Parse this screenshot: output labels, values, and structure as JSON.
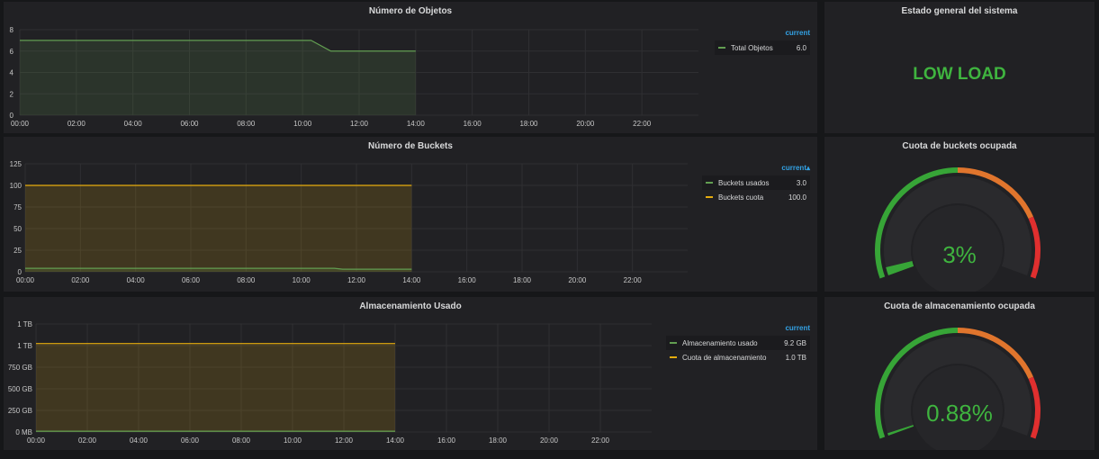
{
  "panels": {
    "objects": {
      "title": "Número de Objetos"
    },
    "status": {
      "title": "Estado general del sistema",
      "value": "LOW LOAD",
      "color": "#3fb43f"
    },
    "buckets": {
      "title": "Número de Buckets"
    },
    "bucket_quota": {
      "title": "Cuota de buckets ocupada",
      "value": "3%"
    },
    "storage": {
      "title": "Almacenamiento Usado"
    },
    "storage_quota": {
      "title": "Cuota de almacenamiento ocupada",
      "value": "0.88%"
    }
  },
  "legends": {
    "objects": {
      "header": "current",
      "items": [
        {
          "name": "Total Objetos",
          "value": "6.0",
          "color": "#629e51"
        }
      ]
    },
    "buckets": {
      "header": "current▴",
      "items": [
        {
          "name": "Buckets usados",
          "value": "3.0",
          "color": "#629e51"
        },
        {
          "name": "Buckets cuota",
          "value": "100.0",
          "color": "#e5ac0e"
        }
      ]
    },
    "storage": {
      "header": "current",
      "items": [
        {
          "name": "Almacenamiento usado",
          "value": "9.2 GB",
          "color": "#629e51"
        },
        {
          "name": "Cuota de almacenamiento",
          "value": "1.0 TB",
          "color": "#e5ac0e"
        }
      ]
    }
  },
  "chart_data": [
    {
      "type": "area",
      "title": "Número de Objetos",
      "x_ticks": [
        "00:00",
        "02:00",
        "04:00",
        "06:00",
        "08:00",
        "10:00",
        "12:00",
        "14:00",
        "16:00",
        "18:00",
        "20:00",
        "22:00"
      ],
      "y_ticks": [
        "0",
        "2",
        "4",
        "6",
        "8"
      ],
      "ylim": [
        0,
        8
      ],
      "series": [
        {
          "name": "Total Objetos",
          "color": "#629e51",
          "x": [
            0,
            10.3,
            11,
            14
          ],
          "y": [
            7,
            7,
            6,
            6
          ]
        }
      ]
    },
    {
      "type": "area",
      "title": "Número de Buckets",
      "x_ticks": [
        "00:00",
        "02:00",
        "04:00",
        "06:00",
        "08:00",
        "10:00",
        "12:00",
        "14:00",
        "16:00",
        "18:00",
        "20:00",
        "22:00"
      ],
      "y_ticks": [
        "0",
        "25",
        "50",
        "75",
        "100",
        "125"
      ],
      "ylim": [
        0,
        125
      ],
      "series": [
        {
          "name": "Buckets cuota",
          "color": "#e5ac0e",
          "x": [
            0,
            14
          ],
          "y": [
            100,
            100
          ]
        },
        {
          "name": "Buckets usados",
          "color": "#629e51",
          "x": [
            0,
            11.2,
            11.5,
            14
          ],
          "y": [
            4,
            4,
            3,
            3
          ]
        }
      ]
    },
    {
      "type": "area",
      "title": "Almacenamiento Usado",
      "x_ticks": [
        "00:00",
        "02:00",
        "04:00",
        "06:00",
        "08:00",
        "10:00",
        "12:00",
        "14:00",
        "16:00",
        "18:00",
        "20:00",
        "22:00"
      ],
      "y_ticks": [
        "0 MB",
        "250 GB",
        "500 GB",
        "750 GB",
        "1 TB",
        "1 TB"
      ],
      "ylim": [
        0,
        1250
      ],
      "series": [
        {
          "name": "Cuota de almacenamiento",
          "color": "#e5ac0e",
          "x": [
            0,
            14
          ],
          "y": [
            1024,
            1024
          ]
        },
        {
          "name": "Almacenamiento usado",
          "color": "#629e51",
          "x": [
            0,
            14
          ],
          "y": [
            9.2,
            9.2
          ]
        }
      ]
    },
    {
      "type": "gauge",
      "title": "Cuota de buckets ocupada",
      "value": 3,
      "thresholds": [
        {
          "color": "#37a537"
        },
        {
          "color": "#e0752d"
        },
        {
          "color": "#e02f2f"
        }
      ]
    },
    {
      "type": "gauge",
      "title": "Cuota de almacenamiento ocupada",
      "value": 0.88,
      "thresholds": [
        {
          "color": "#37a537"
        },
        {
          "color": "#e0752d"
        },
        {
          "color": "#e02f2f"
        }
      ]
    }
  ]
}
